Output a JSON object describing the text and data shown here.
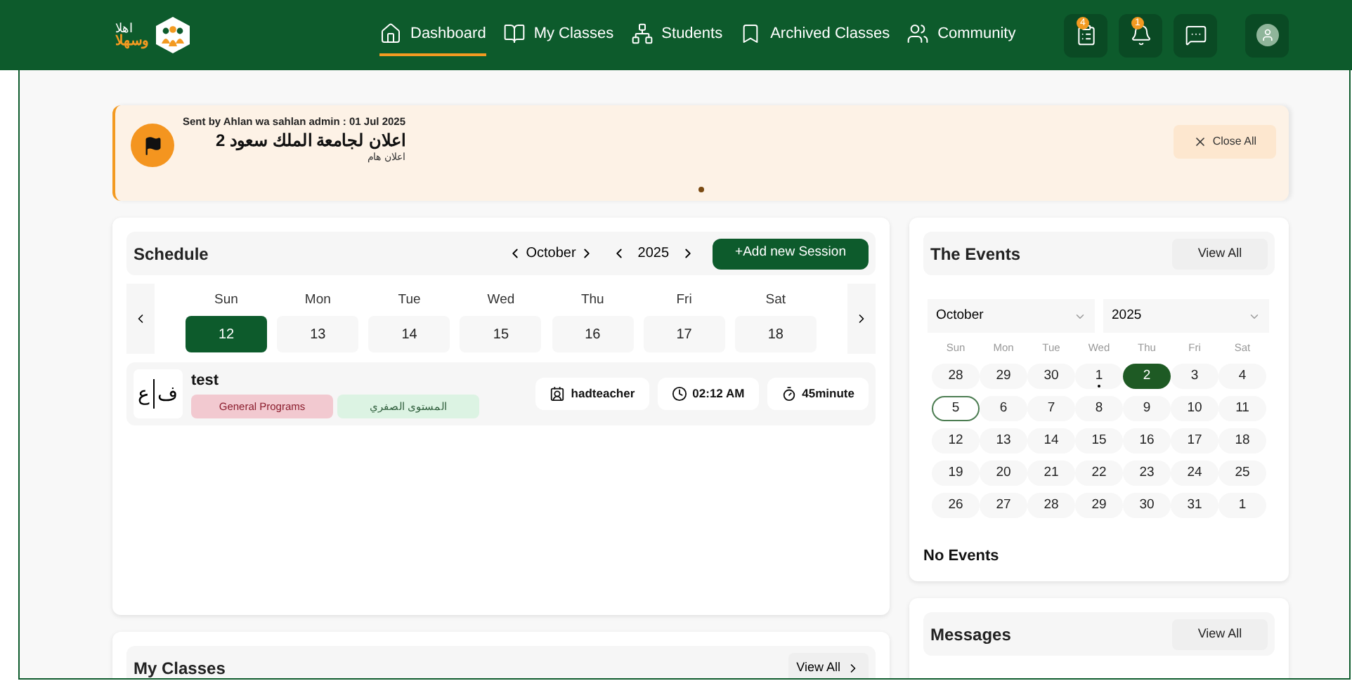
{
  "logo": {
    "line_1": "اهلا",
    "line_2": "وسهلا"
  },
  "nav": [
    {
      "label": "Dashboard",
      "selected": true
    },
    {
      "label": "My Classes",
      "selected": false
    },
    {
      "label": "Students",
      "selected": false
    },
    {
      "label": "Archived Classes",
      "selected": false
    },
    {
      "label": "Community",
      "selected": false
    }
  ],
  "header_actions": [
    {
      "kind": "icon_button",
      "badge": "4"
    },
    {
      "kind": "icon_button",
      "badge": "1"
    },
    {
      "kind": "icon_button"
    },
    {
      "kind": "avatar"
    }
  ],
  "announcement": {
    "meta": "Sent by Ahlan wa sahlan admin : 01 Jul 2025",
    "title": "اعلان لجامعة الملك سعود 2",
    "subtitle": "اعلان هام",
    "close_label": "Close All"
  },
  "schedule": {
    "title": "Schedule",
    "month": "October",
    "year": "2025",
    "add_label": "+Add new Session",
    "days": [
      {
        "name": "Sun",
        "date": "12",
        "selected": true
      },
      {
        "name": "Mon",
        "date": "13",
        "selected": false
      },
      {
        "name": "Tue",
        "date": "14",
        "selected": false
      },
      {
        "name": "Wed",
        "date": "15",
        "selected": false
      },
      {
        "name": "Thu",
        "date": "16",
        "selected": false
      },
      {
        "name": "Fri",
        "date": "17",
        "selected": false
      },
      {
        "name": "Sat",
        "date": "18",
        "selected": false
      }
    ],
    "sessions": [
      {
        "letters": [
          "ف",
          "ع"
        ],
        "title": "test",
        "tags": [
          {
            "label": "General Programs",
            "kind": "program"
          },
          {
            "label": "المستوى الصفري",
            "kind": "level"
          }
        ],
        "info": [
          {
            "kind": "teacher",
            "label": "hadteacher"
          },
          {
            "kind": "time",
            "label": "02:12 AM"
          },
          {
            "kind": "duration",
            "label": "45minute"
          }
        ]
      }
    ]
  },
  "events": {
    "title": "The Events",
    "view_all": "View All",
    "month": "October",
    "year": "2025",
    "weekdays": [
      "Sun",
      "Mon",
      "Tue",
      "Wed",
      "Thu",
      "Fri",
      "Sat"
    ],
    "weeks": [
      [
        {
          "label": "28",
          "selected": false,
          "today": false,
          "has_event": false
        },
        {
          "label": "29",
          "selected": false,
          "today": false,
          "has_event": false
        },
        {
          "label": "30",
          "selected": false,
          "today": false,
          "has_event": false
        },
        {
          "label": "1",
          "selected": false,
          "today": false,
          "has_event": true
        },
        {
          "label": "2",
          "selected": true,
          "today": false,
          "has_event": false
        },
        {
          "label": "3",
          "selected": false,
          "today": false,
          "has_event": false
        },
        {
          "label": "4",
          "selected": false,
          "today": false,
          "has_event": false
        }
      ],
      [
        {
          "label": "5",
          "selected": false,
          "today": true,
          "has_event": false
        },
        {
          "label": "6",
          "selected": false,
          "today": false,
          "has_event": false
        },
        {
          "label": "7",
          "selected": false,
          "today": false,
          "has_event": false
        },
        {
          "label": "8",
          "selected": false,
          "today": false,
          "has_event": false
        },
        {
          "label": "9",
          "selected": false,
          "today": false,
          "has_event": false
        },
        {
          "label": "10",
          "selected": false,
          "today": false,
          "has_event": false
        },
        {
          "label": "11",
          "selected": false,
          "today": false,
          "has_event": false
        }
      ],
      [
        {
          "label": "12",
          "selected": false,
          "today": false,
          "has_event": false
        },
        {
          "label": "13",
          "selected": false,
          "today": false,
          "has_event": false
        },
        {
          "label": "14",
          "selected": false,
          "today": false,
          "has_event": false
        },
        {
          "label": "15",
          "selected": false,
          "today": false,
          "has_event": false
        },
        {
          "label": "16",
          "selected": false,
          "today": false,
          "has_event": false
        },
        {
          "label": "17",
          "selected": false,
          "today": false,
          "has_event": false
        },
        {
          "label": "18",
          "selected": false,
          "today": false,
          "has_event": false
        }
      ],
      [
        {
          "label": "19",
          "selected": false,
          "today": false,
          "has_event": false
        },
        {
          "label": "20",
          "selected": false,
          "today": false,
          "has_event": false
        },
        {
          "label": "21",
          "selected": false,
          "today": false,
          "has_event": false
        },
        {
          "label": "22",
          "selected": false,
          "today": false,
          "has_event": false
        },
        {
          "label": "23",
          "selected": false,
          "today": false,
          "has_event": false
        },
        {
          "label": "24",
          "selected": false,
          "today": false,
          "has_event": false
        },
        {
          "label": "25",
          "selected": false,
          "today": false,
          "has_event": false
        }
      ],
      [
        {
          "label": "26",
          "selected": false,
          "today": false,
          "has_event": false
        },
        {
          "label": "27",
          "selected": false,
          "today": false,
          "has_event": false
        },
        {
          "label": "28",
          "selected": false,
          "today": false,
          "has_event": false
        },
        {
          "label": "29",
          "selected": false,
          "today": false,
          "has_event": false
        },
        {
          "label": "30",
          "selected": false,
          "today": false,
          "has_event": false
        },
        {
          "label": "31",
          "selected": false,
          "today": false,
          "has_event": false
        },
        {
          "label": "1",
          "selected": false,
          "today": false,
          "has_event": false
        }
      ]
    ],
    "empty_text": "No Events"
  },
  "my_classes": {
    "title": "My Classes",
    "view_all": "View All"
  },
  "messages": {
    "title": "Messages",
    "view_all": "View All"
  }
}
